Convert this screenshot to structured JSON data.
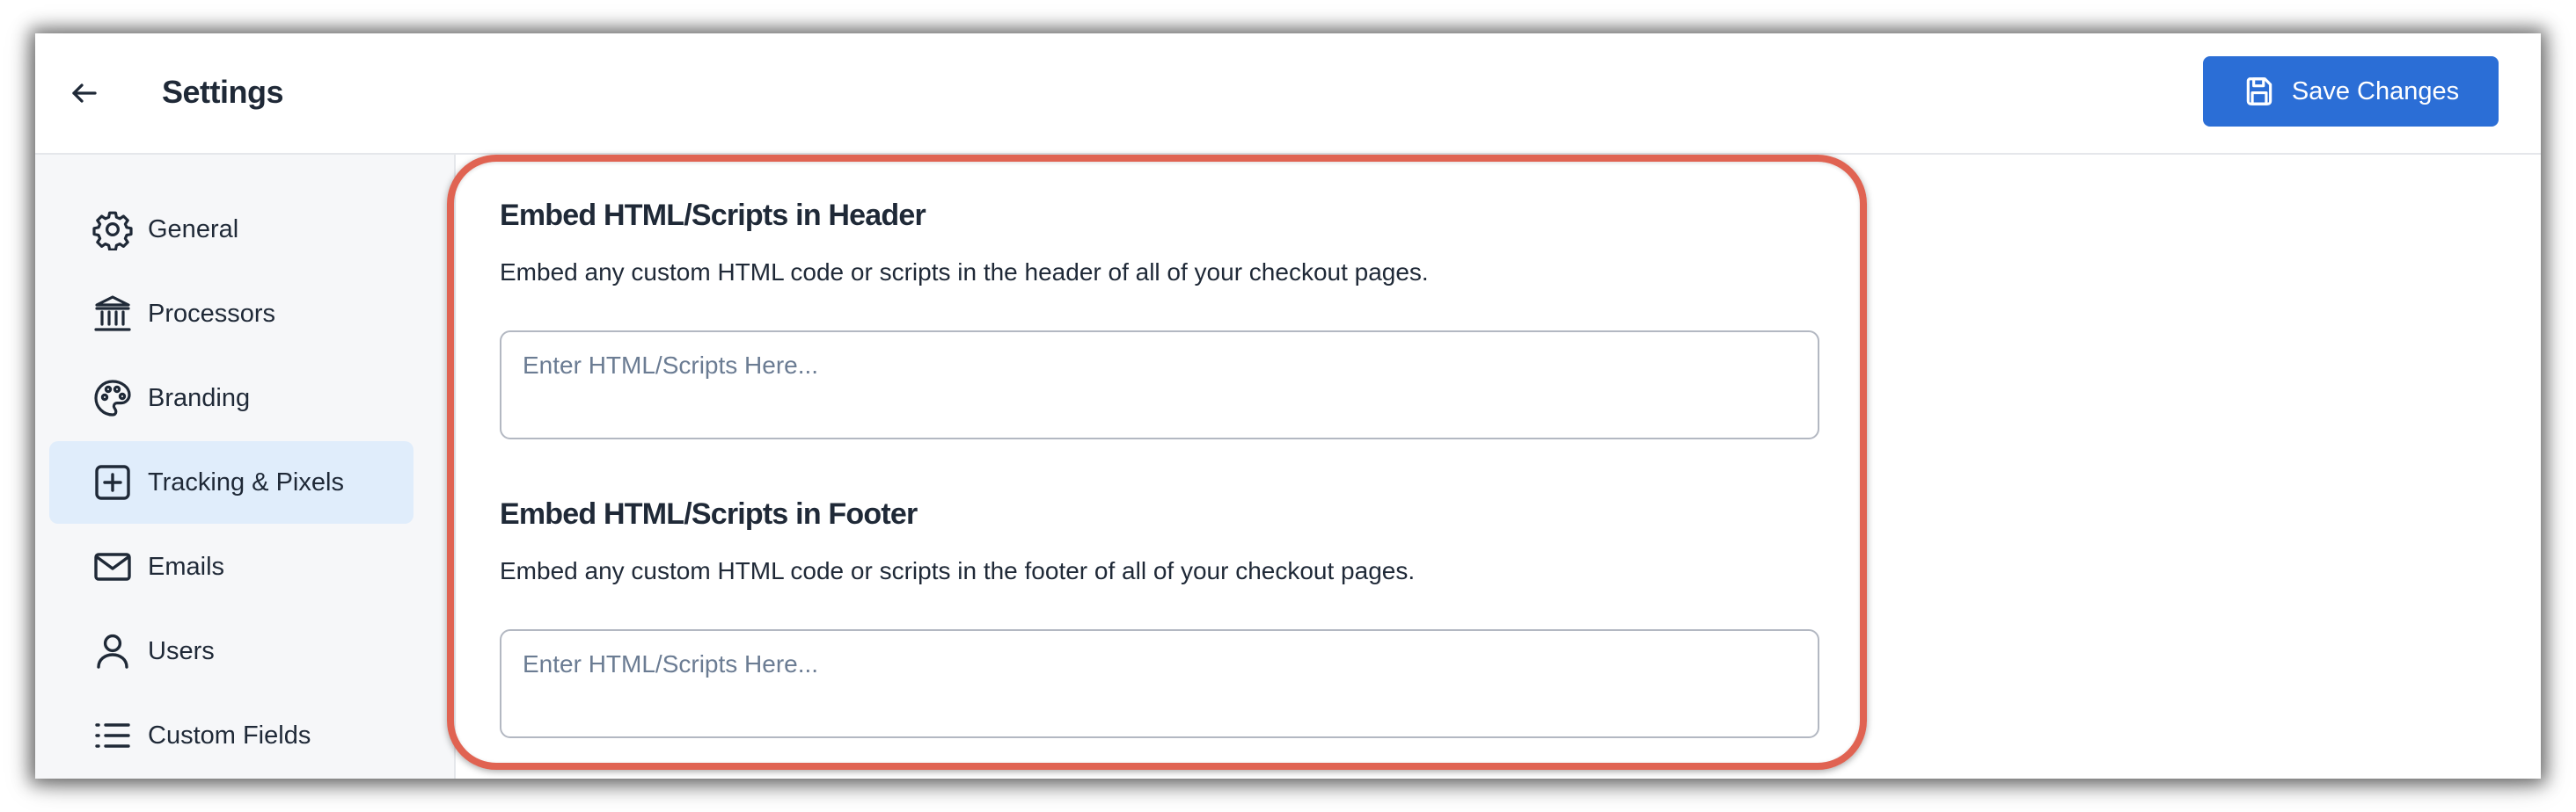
{
  "header": {
    "title": "Settings",
    "back_icon": "arrow-left-icon",
    "save_label": "Save Changes",
    "save_icon": "floppy-disk-icon"
  },
  "sidebar": {
    "items": [
      {
        "label": "General",
        "icon": "gear-icon",
        "active": false
      },
      {
        "label": "Processors",
        "icon": "bank-icon",
        "active": false
      },
      {
        "label": "Branding",
        "icon": "palette-icon",
        "active": false
      },
      {
        "label": "Tracking & Pixels",
        "icon": "plus-square-icon",
        "active": true
      },
      {
        "label": "Emails",
        "icon": "envelope-icon",
        "active": false
      },
      {
        "label": "Users",
        "icon": "user-icon",
        "active": false
      },
      {
        "label": "Custom Fields",
        "icon": "list-icon",
        "active": false
      }
    ]
  },
  "main": {
    "header_section": {
      "title": "Embed HTML/Scripts in Header",
      "description": "Embed any custom HTML code or scripts in the header of all of your checkout pages.",
      "placeholder": "Enter HTML/Scripts Here...",
      "value": ""
    },
    "footer_section": {
      "title": "Embed HTML/Scripts in Footer",
      "description": "Embed any custom HTML code or scripts in the footer of all of your checkout pages.",
      "placeholder": "Enter HTML/Scripts Here...",
      "value": ""
    }
  },
  "colors": {
    "accent": "#2b6ed6",
    "active_nav_bg": "#e0edfb",
    "highlight_outline": "#e06352"
  }
}
